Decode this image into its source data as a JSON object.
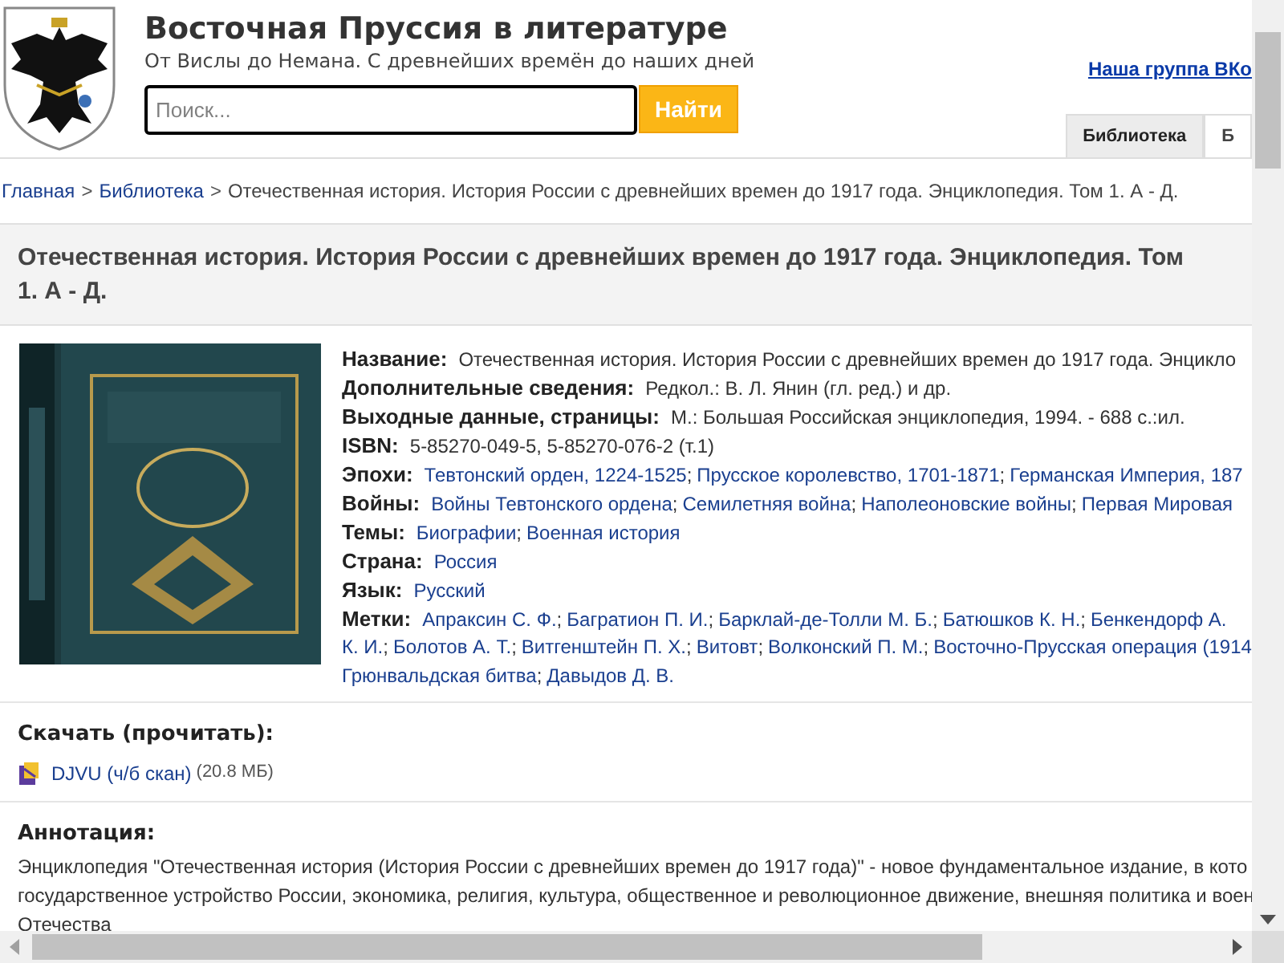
{
  "site": {
    "title": "Восточная Пруссия в литературе",
    "subtitle": "От Вислы до Немана. С древнейших времён до наших дней",
    "search": {
      "placeholder": "Поиск...",
      "button": "Найти"
    },
    "group_link": "Наша группа ВКо",
    "tabs": [
      {
        "label": "Библиотека",
        "selected": true
      },
      {
        "label": "Б",
        "selected": false
      }
    ]
  },
  "breadcrumb_separator": ">",
  "breadcrumb": [
    {
      "label": "Главная",
      "kind": "link"
    },
    {
      "label": "Библиотека",
      "kind": "link"
    },
    {
      "label": "Отечественная история. История России с древнейших времен до 1917 года. Энциклопедия. Том 1. А - Д.",
      "kind": "current"
    }
  ],
  "book": {
    "link_separator": ";",
    "title": "Отечественная история. История России с древнейших времен до 1917 года. Энциклопедия. Том 1. А - Д.",
    "fields": [
      {
        "label": "Название:",
        "kind": "text",
        "value": "Отечественная история. История России с древнейших времен до 1917 года. Энцикло"
      },
      {
        "label": "Дополнительные сведения:",
        "kind": "text",
        "value": "Редкол.: В. Л. Янин (гл. ред.) и др."
      },
      {
        "label": "Выходные данные, страницы:",
        "kind": "text",
        "value": "М.: Большая Российская энциклопедия, 1994. - 688 с.:ил."
      },
      {
        "label": "ISBN:",
        "kind": "text",
        "value": "5-85270-049-5, 5-85270-076-2 (т.1)"
      },
      {
        "label": "Эпохи:",
        "kind": "links",
        "links": [
          "Тевтонский орден, 1224-1525",
          "Прусское королевство, 1701-1871",
          "Германская Империя, 187"
        ]
      },
      {
        "label": "Войны:",
        "kind": "links",
        "links": [
          "Войны Тевтонского ордена",
          "Семилетняя война",
          "Наполеоновские войны",
          "Первая Мировая"
        ]
      },
      {
        "label": "Темы:",
        "kind": "links",
        "links": [
          "Биографии",
          "Военная история"
        ]
      },
      {
        "label": "Страна:",
        "kind": "links",
        "links": [
          "Россия"
        ]
      },
      {
        "label": "Язык:",
        "kind": "links",
        "links": [
          "Русский"
        ]
      },
      {
        "label": "Метки:",
        "kind": "lines",
        "lines": [
          [
            "Апраксин С. Ф.",
            "Багратион П. И.",
            "Барклай-де-Толли М. Б.",
            "Батюшков К. Н.",
            "Бенкендорф А."
          ],
          [
            "К. И.",
            "Болотов А. Т.",
            "Витгенштейн П. Х.",
            "Витовт",
            "Волконский П. М.",
            "Восточно-Прусская операция (1914"
          ],
          [
            "Грюнвальдская битва",
            "Давыдов Д. В."
          ]
        ]
      }
    ]
  },
  "download": {
    "heading": "Скачать (прочитать):",
    "files": [
      {
        "link": "DJVU (ч/б скан)",
        "size": "(20.8 МБ)"
      }
    ]
  },
  "annotation": {
    "heading": "Аннотация:",
    "lines": [
      "Энциклопедия \"Отечественная история (История России с древнейших времен до 1917 года)\" - новое фундаментальное издание, в кото",
      "государственное устройство России, экономика, религия, культура, общественное и революционное движение, внешняя политика и воен",
      "Отечества"
    ]
  }
}
